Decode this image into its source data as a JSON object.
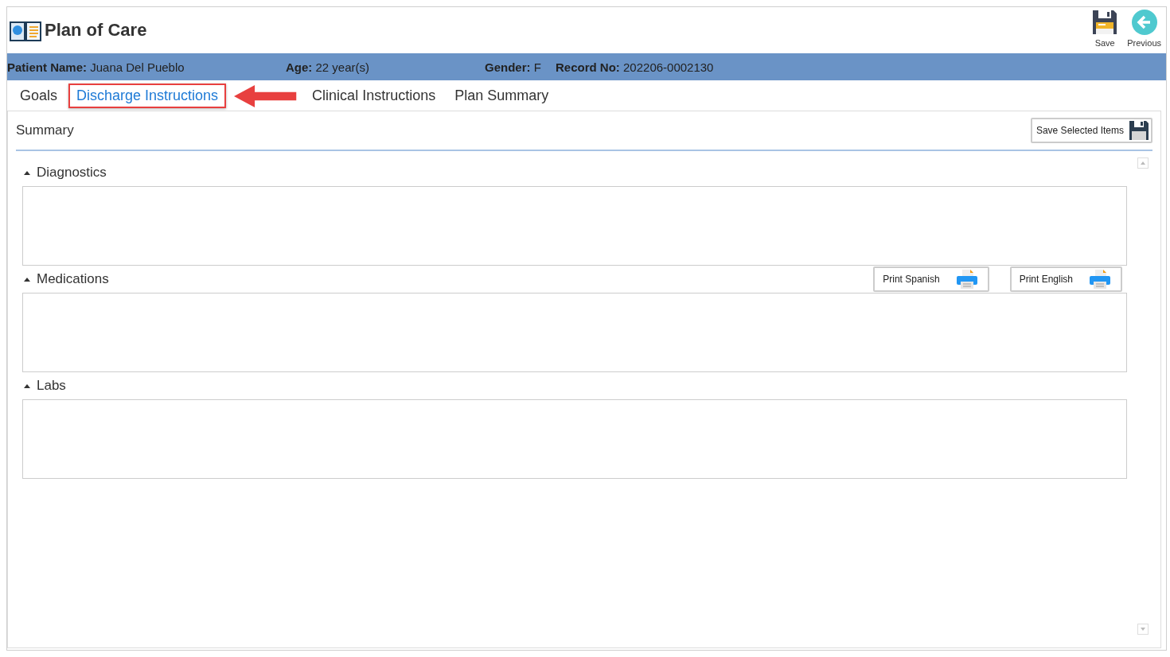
{
  "window": {
    "title": "Plan of Care"
  },
  "toolbar": [
    {
      "kind": "save",
      "label": "Save"
    },
    {
      "kind": "previous",
      "label": "Previous"
    }
  ],
  "patient": [
    {
      "label": "Patient Name:",
      "value": "Juana Del Pueblo"
    },
    {
      "label": "Age:",
      "value": "22 year(s)"
    },
    {
      "label": "Gender:",
      "value": "F"
    },
    {
      "label": "Record No:",
      "value": "202206-0002130"
    }
  ],
  "tabs": [
    {
      "label": "Goals",
      "selected": false
    },
    {
      "label": "Discharge Instructions",
      "selected": true
    },
    {
      "label": "Clinical Instructions",
      "selected": false
    },
    {
      "label": "Plan Summary",
      "selected": false
    }
  ],
  "annotations": {
    "highlight_selected_tab": true,
    "arrow": true
  },
  "summary": {
    "title": "Summary",
    "button": "Save Selected Items"
  },
  "sections": [
    {
      "title": "Diagnostics",
      "expanded": true
    },
    {
      "title": "Medications",
      "expanded": true,
      "buttons": [
        "Print Spanish",
        "Print English"
      ]
    },
    {
      "title": "Labs",
      "expanded": true
    }
  ]
}
